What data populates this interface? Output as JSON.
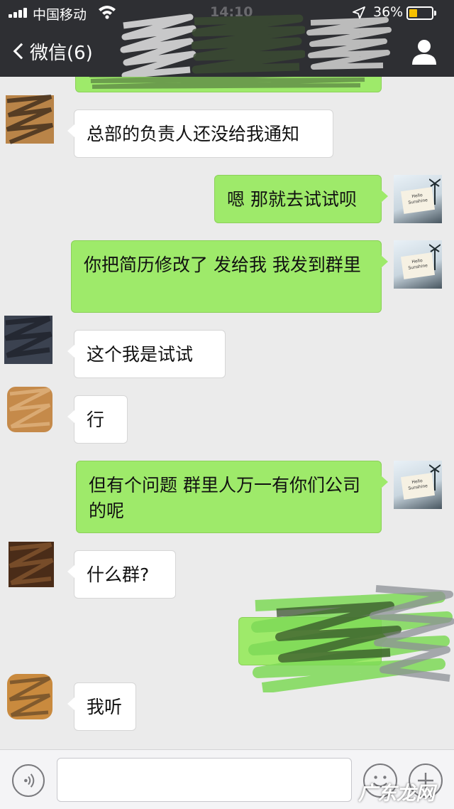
{
  "status_bar": {
    "carrier": "中国移动",
    "time": "14:10",
    "battery_percent_text": "36%",
    "battery_level": 0.36,
    "icons": [
      "signal-icon",
      "wifi-icon",
      "location-arrow-icon",
      "battery-icon"
    ]
  },
  "nav": {
    "back_icon": "chevron-left-icon",
    "title": "微信(6)",
    "profile_icon": "person-icon"
  },
  "messages": [
    {
      "side": "in",
      "text": "总部的负责人还没给我通知"
    },
    {
      "side": "out",
      "text": "嗯 那就去试试呗"
    },
    {
      "side": "out",
      "text": "你把简历修改了 发给我 我发到群里"
    },
    {
      "side": "in",
      "text": "这个我是试试"
    },
    {
      "side": "in",
      "text": "行"
    },
    {
      "side": "out",
      "text": "但有个问题 群里人万一有你们公司的呢"
    },
    {
      "side": "in",
      "text": "什么群?"
    },
    {
      "side": "out",
      "text": ""
    },
    {
      "side": "in",
      "text": "我听"
    }
  ],
  "self_avatar_card_text": "Hello Sunshine",
  "input_bar": {
    "voice_icon": "voice-icon",
    "input_value": "",
    "emoji_icon": "emoji-icon",
    "plus_icon": "plus-icon"
  },
  "watermark": "广东龙网",
  "colors": {
    "nav_bg": "#2e2f33",
    "chat_bg": "#ebebeb",
    "sent_bubble": "#9eea6a",
    "received_bubble": "#ffffff",
    "battery_fill": "#f6c000"
  }
}
